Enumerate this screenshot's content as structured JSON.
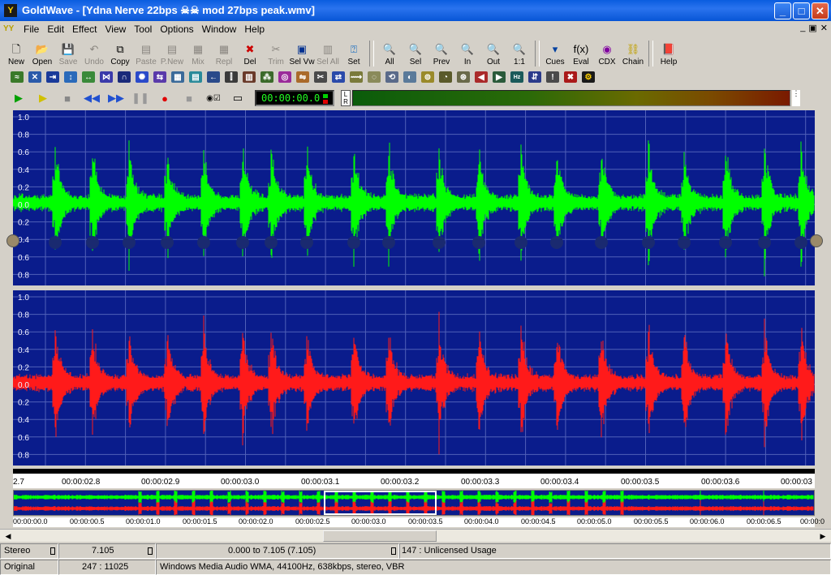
{
  "window": {
    "title": "GoldWave - [Ydna Nerve 22bps ☠☠ mod 27bps peak.wmv]",
    "app_icon_glyph": "Y",
    "minimize_glyph": "_",
    "maximize_glyph": "□",
    "close_glyph": "✕"
  },
  "menu": {
    "items": [
      "File",
      "Edit",
      "Effect",
      "View",
      "Tool",
      "Options",
      "Window",
      "Help"
    ],
    "mdi_icon": "YY",
    "mdi_min": "_",
    "mdi_restore": "▣",
    "mdi_close": "✕"
  },
  "toolbar": {
    "new": "New",
    "open": "Open",
    "save": "Save",
    "undo": "Undo",
    "copy": "Copy",
    "paste": "Paste",
    "pnew": "P.New",
    "mix": "Mix",
    "repl": "Repl",
    "del": "Del",
    "trim": "Trim",
    "selvw": "Sel Vw",
    "selall": "Sel All",
    "set": "Set",
    "all": "All",
    "sel": "Sel",
    "prev": "Prev",
    "in": "In",
    "out": "Out",
    "oneone": "1:1",
    "cues": "Cues",
    "eval": "Eval",
    "cdx": "CDX",
    "chain": "Chain",
    "help": "Help"
  },
  "transport": {
    "time": "00:00:00.0",
    "meter_l": "L",
    "meter_r": "R"
  },
  "waveform": {
    "left_channel_color": "#00ff00",
    "right_channel_color": "#ff1a1a",
    "background_color": "#0a1c8c",
    "y_labels": [
      "1.0",
      "0.8",
      "0.6",
      "0.4",
      "0.2",
      "0.0",
      "0.2",
      "0.4",
      "0.6",
      "0.8"
    ]
  },
  "ruler": {
    "labels": [
      "2.7",
      "00:00:02.8",
      "00:00:02.9",
      "00:00:03.0",
      "00:00:03.1",
      "00:00:03.2",
      "00:00:03.3",
      "00:00:03.4",
      "00:00:03.5",
      "00:00:03.6",
      "00:00:03"
    ]
  },
  "overview_ruler": {
    "labels": [
      "00:00:00.0",
      "00:00:00.5",
      "00:00:01.0",
      "00:00:01.5",
      "00:00:02.0",
      "00:00:02.5",
      "00:00:03.0",
      "00:00:03.5",
      "00:00:04.0",
      "00:00:04.5",
      "00:00:05.0",
      "00:00:05.5",
      "00:00:06.0",
      "00:00:06.5",
      "00:00:0"
    ]
  },
  "status": {
    "channels": "Stereo",
    "length": "7.105",
    "selection": "0.000 to 7.105 (7.105)",
    "license": "147 : Unlicensed Usage",
    "mode": "Original",
    "position": "247 : 11025",
    "format": "Windows Media Audio WMA, 44100Hz, 638kbps, stereo, VBR"
  }
}
